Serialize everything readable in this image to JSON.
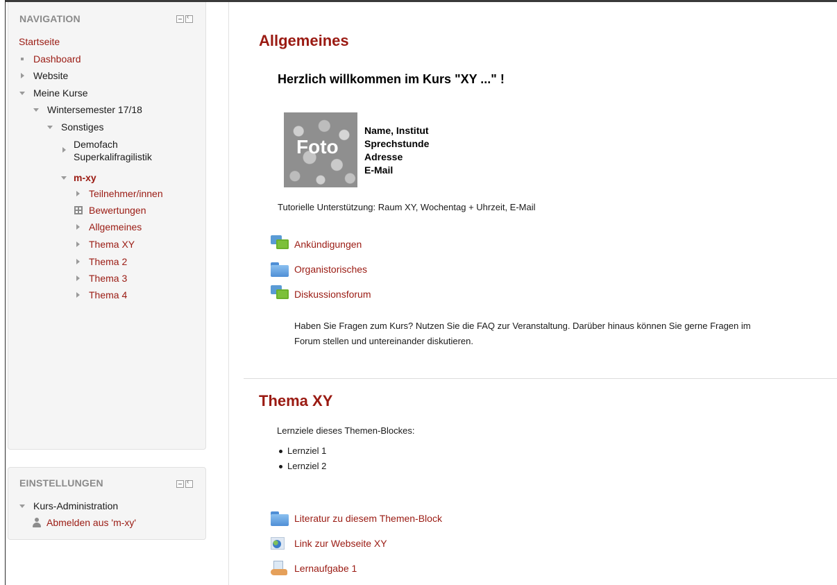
{
  "navigation": {
    "header": "NAVIGATION",
    "home": "Startseite",
    "dashboard": "Dashboard",
    "website": "Website",
    "my_courses": "Meine Kurse",
    "semester": "Wintersemester 17/18",
    "category": "Sonstiges",
    "course_other_line1": "Demofach",
    "course_other_line2": "Superkalifragilistik",
    "current_course": "m-xy",
    "course_items": [
      "Teilnehmer/innen",
      "Bewertungen",
      "Allgemeines",
      "Thema XY",
      "Thema 2",
      "Thema 3",
      "Thema 4"
    ]
  },
  "settings": {
    "header": "EINSTELLUNGEN",
    "course_admin": "Kurs-Administration",
    "unenrol": "Abmelden aus 'm-xy'"
  },
  "section_general": {
    "title": "Allgemeines",
    "welcome": "Herzlich willkommen im Kurs \"XY ...\" !",
    "photo_label": "Foto",
    "contact_lines": [
      "Name, Institut",
      "Sprechstunde",
      "Adresse",
      "E-Mail"
    ],
    "tutorial": "Tutorielle Unterstützung: Raum XY, Wochentag + Uhrzeit, E-Mail",
    "activities": [
      {
        "label": "Ankündigungen",
        "icon": "forum-icon"
      },
      {
        "label": "Organistorisches",
        "icon": "folder-icon"
      },
      {
        "label": "Diskussionsforum",
        "icon": "forum-icon"
      }
    ],
    "forum_desc_line1": "Haben Sie Fragen zum Kurs? Nutzen Sie die FAQ zur Veranstaltung. Darüber hinaus können Sie gerne Fragen im",
    "forum_desc_line2": "Forum stellen und untereinander diskutieren."
  },
  "section_topic": {
    "title": "Thema XY",
    "goals_intro": "Lernziele dieses Themen-Blockes:",
    "goals": [
      "Lernziel 1",
      "Lernziel 2"
    ],
    "activities": [
      {
        "label": "Literatur zu diesem Themen-Block",
        "icon": "folder-icon"
      },
      {
        "label": "Link zur Webseite XY",
        "icon": "url-icon"
      },
      {
        "label": "Lernaufgabe 1",
        "icon": "assignment-icon"
      }
    ]
  },
  "colors": {
    "link": "#9a1a12",
    "block_header": "#8a8a8a",
    "block_bg": "#f5f5f5"
  }
}
